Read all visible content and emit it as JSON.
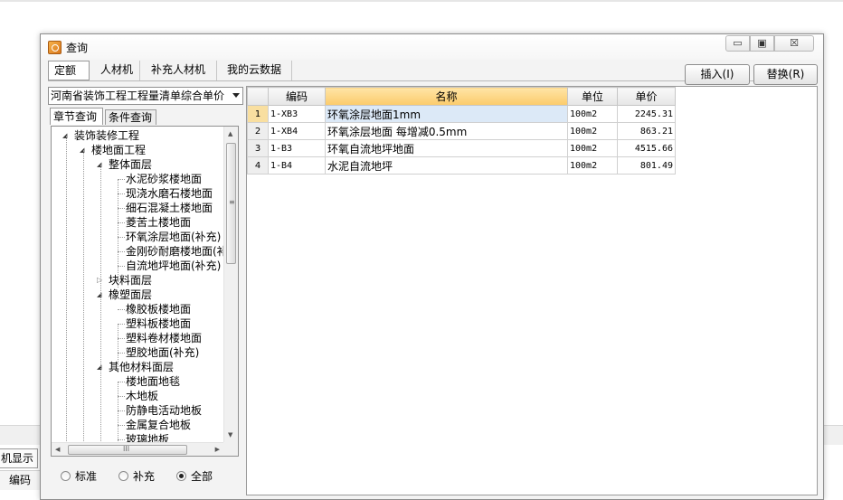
{
  "background": {
    "tab1": "机显示",
    "tab2": "编码"
  },
  "dialog": {
    "title": "查询",
    "window_buttons": {
      "minimize": "▭",
      "maximize": "▣",
      "close": "☒"
    }
  },
  "top_tabs": [
    "定额",
    "人材机",
    "补充人材机",
    "我的云数据"
  ],
  "actions": {
    "insert": "插入(I)",
    "replace": "替换(R)"
  },
  "library_select": {
    "value": "河南省装饰工程工程量清单综合单价"
  },
  "sub_tabs": [
    "章节查询",
    "条件查询"
  ],
  "tree": [
    {
      "label": "装饰装修工程",
      "level": 0,
      "toggle": "open"
    },
    {
      "label": "楼地面工程",
      "level": 1,
      "toggle": "open"
    },
    {
      "label": "整体面层",
      "level": 2,
      "toggle": "open"
    },
    {
      "label": "水泥砂浆楼地面",
      "level": 3
    },
    {
      "label": "现浇水磨石楼地面",
      "level": 3
    },
    {
      "label": "细石混凝土楼地面",
      "level": 3
    },
    {
      "label": "菱苦土楼地面",
      "level": 3
    },
    {
      "label": "环氧涂层地面(补充)",
      "level": 3
    },
    {
      "label": "金刚砂耐磨楼地面(补",
      "level": 3
    },
    {
      "label": "自流地坪地面(补充)",
      "level": 3
    },
    {
      "label": "块料面层",
      "level": 2,
      "toggle": "closed"
    },
    {
      "label": "橡塑面层",
      "level": 2,
      "toggle": "open"
    },
    {
      "label": "橡胶板楼地面",
      "level": 3
    },
    {
      "label": "塑料板楼地面",
      "level": 3
    },
    {
      "label": "塑料卷材楼地面",
      "level": 3
    },
    {
      "label": "塑胶地面(补充)",
      "level": 3
    },
    {
      "label": "其他材料面层",
      "level": 2,
      "toggle": "open"
    },
    {
      "label": "楼地面地毯",
      "level": 3
    },
    {
      "label": "木地板",
      "level": 3
    },
    {
      "label": "防静电活动地板",
      "level": 3
    },
    {
      "label": "金属复合地板",
      "level": 3
    },
    {
      "label": "玻璃地板",
      "level": 3
    }
  ],
  "scroll_glyphs": {
    "up": "▲",
    "down": "▼",
    "left": "◀",
    "right": "▶",
    "vgrip": "≡",
    "hgrip": "III"
  },
  "filter_radios": [
    {
      "label": "标准",
      "checked": false
    },
    {
      "label": "补充",
      "checked": false
    },
    {
      "label": "全部",
      "checked": true
    }
  ],
  "grid": {
    "columns": [
      "",
      "编码",
      "名称",
      "单位",
      "单价"
    ],
    "rows": [
      {
        "num": "1",
        "code": "1-XB3",
        "name": "环氧涂层地面1mm",
        "unit": "100m2",
        "price": "2245.31",
        "selected": true
      },
      {
        "num": "2",
        "code": "1-XB4",
        "name": "环氧涂层地面 每增减0.5mm",
        "unit": "100m2",
        "price": "863.21",
        "selected": false
      },
      {
        "num": "3",
        "code": "1-B3",
        "name": "环氧自流地坪地面",
        "unit": "100m2",
        "price": "4515.66",
        "selected": false
      },
      {
        "num": "4",
        "code": "1-B4",
        "name": "水泥自流地坪",
        "unit": "100m2",
        "price": "801.49",
        "selected": false
      }
    ]
  }
}
